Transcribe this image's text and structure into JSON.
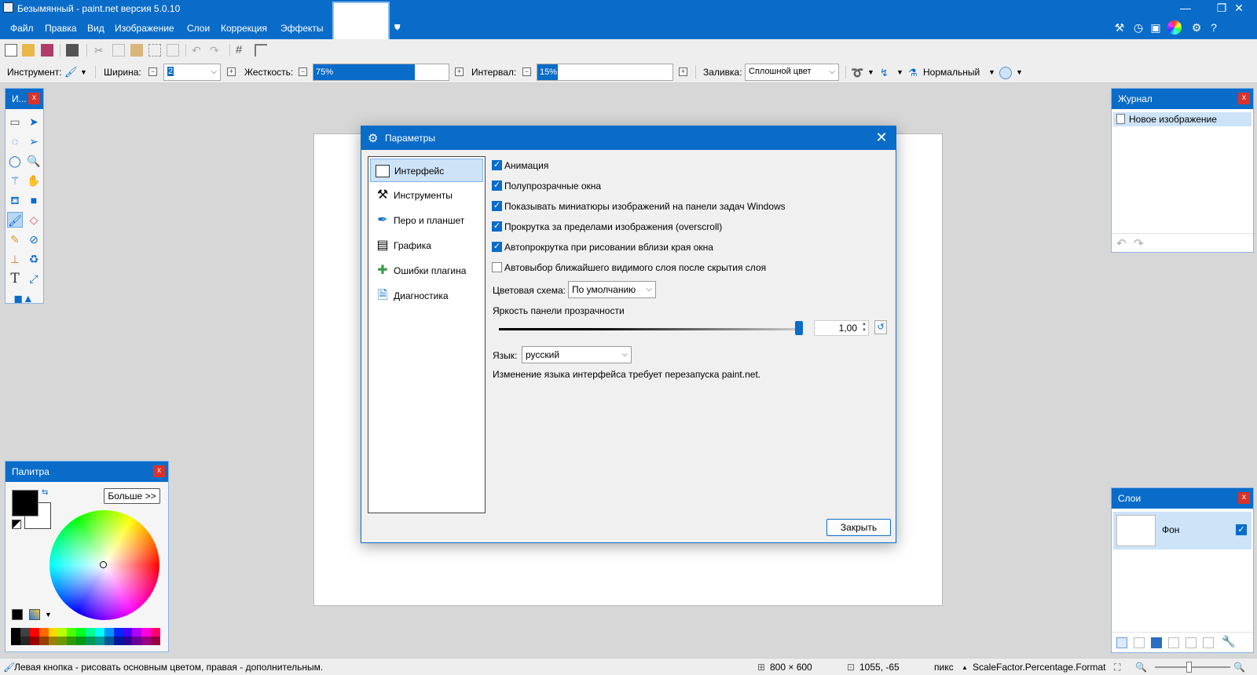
{
  "window": {
    "title": "Безымянный - paint.net версия 5.0.10",
    "min": "—",
    "restore": "❐",
    "close": "✕"
  },
  "menu": [
    "Файл",
    "Правка",
    "Вид",
    "Изображение",
    "Слои",
    "Коррекция",
    "Эффекты"
  ],
  "toolbar": {
    "tool_label": "Инструмент:",
    "width_label": "Ширина:",
    "width_value": "2",
    "hardness_label": "Жесткость:",
    "hardness_value": "75%",
    "hardness_fraction": 0.75,
    "interval_label": "Интервал:",
    "interval_value": "15%",
    "interval_fraction": 0.15,
    "fill_label": "Заливка:",
    "fill_value": "Сплошной цвет",
    "blend_value": "Нормальный"
  },
  "tools_panel": {
    "title": "И..."
  },
  "history_panel": {
    "title": "Журнал",
    "items": [
      "Новое изображение"
    ]
  },
  "palette_panel": {
    "title": "Палитра",
    "more_button": "Больше >>",
    "primary_color": "#000000",
    "secondary_color": "#ffffff",
    "swatch_colors": [
      "#000000",
      "#404040",
      "#ff0000",
      "#ff6a00",
      "#ffd800",
      "#b6ff00",
      "#4cff00",
      "#00ff21",
      "#00ff90",
      "#00ffff",
      "#0094ff",
      "#0026ff",
      "#4800ff",
      "#b200ff",
      "#ff00dc",
      "#ff006e"
    ]
  },
  "layers_panel": {
    "title": "Слои",
    "layer_name": "Фон"
  },
  "status": {
    "hint": "Левая кнопка - рисовать основным цветом, правая - дополнительным.",
    "size": "800 × 600",
    "coords": "1055, -65",
    "units": "пикс",
    "scale": "ScaleFactor.Percentage.Format"
  },
  "dialog": {
    "title": "Параметры",
    "nav": [
      {
        "label": "Интерфейс",
        "icon": "window-icon"
      },
      {
        "label": "Инструменты",
        "icon": "hammer-icon"
      },
      {
        "label": "Перо и планшет",
        "icon": "pen-icon"
      },
      {
        "label": "Графика",
        "icon": "gpu-icon"
      },
      {
        "label": "Ошибки плагина",
        "icon": "plugin-icon"
      },
      {
        "label": "Диагностика",
        "icon": "diagnostics-icon"
      }
    ],
    "checkboxes": [
      {
        "label": "Анимация",
        "checked": true
      },
      {
        "label": "Полупрозрачные окна",
        "checked": true
      },
      {
        "label": "Показывать миниатюры изображений на панели задач Windows",
        "checked": true
      },
      {
        "label": "Прокрутка за пределами изображения (overscroll)",
        "checked": true
      },
      {
        "label": "Автопрокрутка при рисовании вблизи края окна",
        "checked": true
      },
      {
        "label": "Автовыбор ближайшего видимого слоя после скрытия слоя",
        "checked": false
      }
    ],
    "color_scheme_label": "Цветовая схема:",
    "color_scheme_value": "По умолчанию",
    "brightness_label": "Яркость панели прозрачности",
    "brightness_value": "1,00",
    "language_label": "Язык:",
    "language_value": "русский",
    "language_note": "Изменение языка интерфейса требует перезапуска paint.net.",
    "close_button": "Закрыть"
  },
  "colors": {
    "accent": "#0a6cc9",
    "workspace": "#d7d7d7"
  }
}
